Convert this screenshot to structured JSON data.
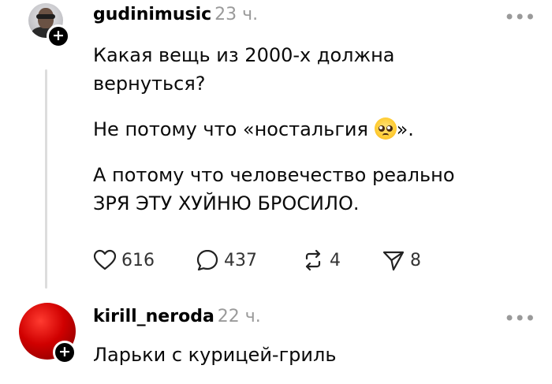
{
  "posts": [
    {
      "username": "gudinimusic",
      "time": "23 ч.",
      "more_icon": "more-horizontal-icon",
      "paragraphs": [
        "Какая вещь из 2000-х должна",
        "вернуться?",
        "Не потому что «ностальгия",
        "».",
        "А потому что человечество реально",
        "ЗРЯ ЭТУ ХУЙНЮ БРОСИЛО."
      ],
      "emoji": "pleading-face-emoji",
      "actions": {
        "likes": "616",
        "comments": "437",
        "reposts": "4",
        "shares": "8"
      }
    },
    {
      "username": "kirill_neroda",
      "time": "22 ч.",
      "more_icon": "more-horizontal-icon",
      "text": "Ларьки с курицей-гриль"
    }
  ],
  "follow_badge": "+",
  "colors": {
    "text": "#000000",
    "muted": "#9a9a9a",
    "thread_line": "#dddddd",
    "avatar_red": "#d00000"
  }
}
